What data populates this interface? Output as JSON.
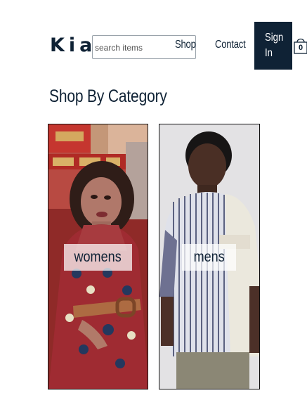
{
  "header": {
    "logo": "Kia",
    "search": {
      "placeholder": "search items",
      "value": ""
    },
    "nav": {
      "shop": "Shop",
      "contact": "Contact",
      "sign_in": [
        "Sign",
        "In"
      ]
    },
    "cart": {
      "count": "0",
      "icon": "shopping-bag-icon"
    }
  },
  "main": {
    "section_title": "Shop By Category",
    "categories": [
      {
        "label": "womens"
      },
      {
        "label": "mens"
      }
    ]
  },
  "colors": {
    "brand_navy": "#0f2235",
    "background": "#ffffff"
  }
}
